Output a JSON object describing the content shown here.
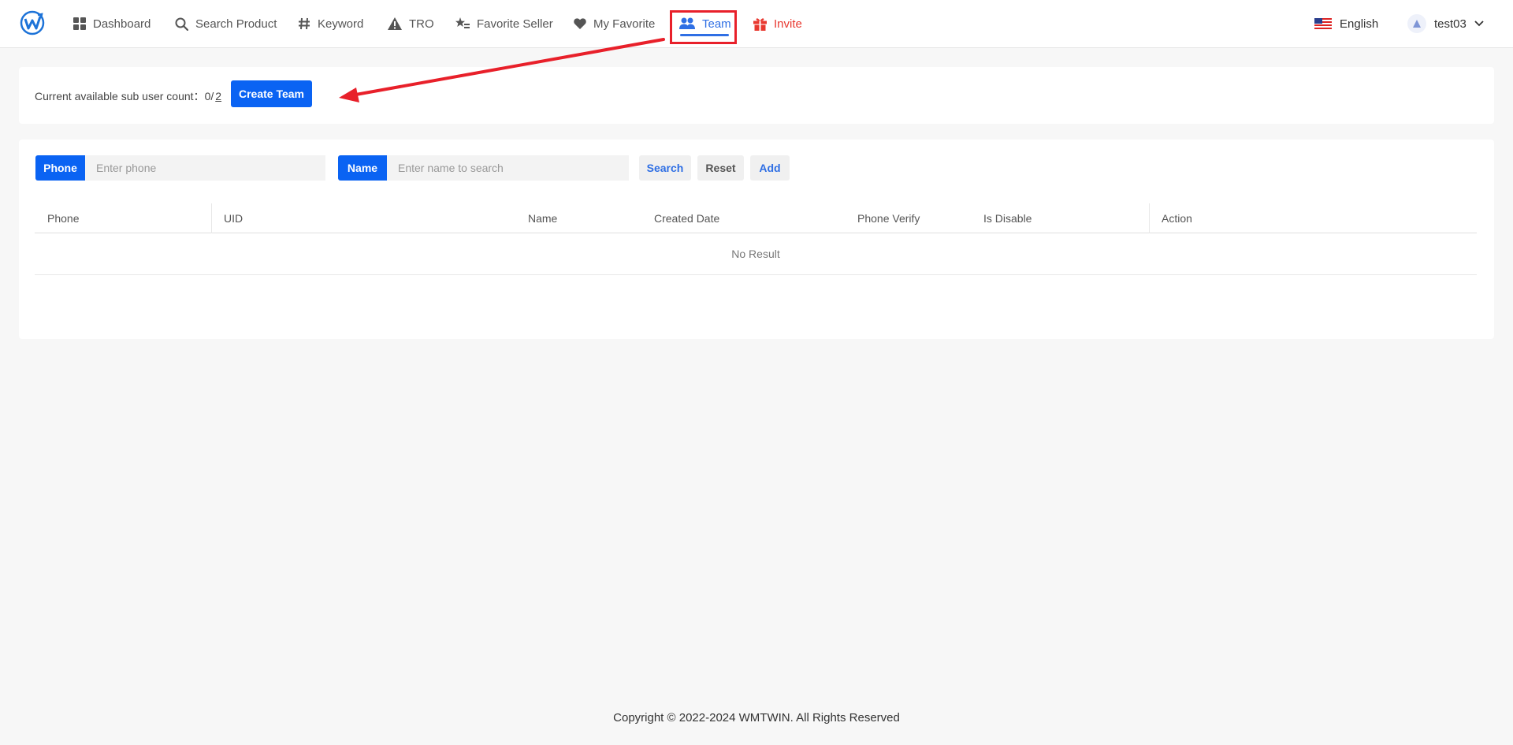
{
  "nav": {
    "items": [
      {
        "label": "Dashboard",
        "icon": "grid-icon"
      },
      {
        "label": "Search Product",
        "icon": "search-icon"
      },
      {
        "label": "Keyword",
        "icon": "hash-icon"
      },
      {
        "label": "TRO",
        "icon": "warning-icon"
      },
      {
        "label": "Favorite Seller",
        "icon": "star-list-icon"
      },
      {
        "label": "My Favorite",
        "icon": "heart-icon"
      },
      {
        "label": "Team",
        "icon": "users-icon",
        "active": true
      },
      {
        "label": "Invite",
        "icon": "gift-icon"
      }
    ],
    "language": "English",
    "username": "test03"
  },
  "subuser": {
    "label": "Current available sub user count：",
    "used": "0/",
    "total": "2",
    "create_button": "Create Team"
  },
  "filters": {
    "phone_label": "Phone",
    "phone_placeholder": "Enter phone",
    "name_label": "Name",
    "name_placeholder": "Enter name to search",
    "search_button": "Search",
    "reset_button": "Reset",
    "add_button": "Add"
  },
  "table": {
    "columns": [
      "Phone",
      "UID",
      "Name",
      "Created Date",
      "Phone Verify",
      "Is Disable",
      "Action"
    ],
    "empty_text": "No Result"
  },
  "footer": {
    "copyright": "Copyright © 2022-2024 WMTWIN. All Rights Reserved"
  },
  "colors": {
    "primary": "#0a63f3",
    "active_nav": "#2f6fe4",
    "invite": "#e8382f",
    "annotation": "#e8202a"
  }
}
